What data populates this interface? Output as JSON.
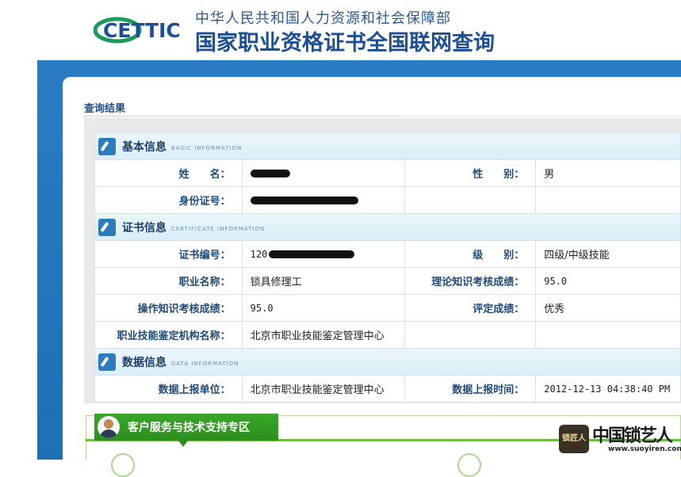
{
  "header": {
    "logo_text": "CETTIC",
    "org_name": "中华人民共和国人力资源和社会保障部",
    "site_title": "国家职业资格证书全国联网查询"
  },
  "result_title": "查询结果",
  "sections": {
    "basic": {
      "name": "基本信息",
      "en": "BASIC INFORMATION"
    },
    "cert": {
      "name": "证书信息",
      "en": "CERTIFICATE INFORMATION"
    },
    "data": {
      "name": "数据信息",
      "en": "DATA INFORMATION"
    }
  },
  "basic": {
    "name_label": "姓　　名：",
    "name_value": "",
    "gender_label": "性　　别：",
    "gender_value": "男",
    "id_label": "身份证号：",
    "id_value": ""
  },
  "cert": {
    "number_label": "证书编号：",
    "number_prefix": "120",
    "level_label": "级　　别：",
    "level_value": "四级/中级技能",
    "occupation_label": "职业名称：",
    "occupation_value": "锁具修理工",
    "theory_label": "理论知识考核成绩：",
    "theory_value": "95.0",
    "practice_label": "操作知识考核成绩：",
    "practice_value": "95.0",
    "rating_label": "评定成绩：",
    "rating_value": "优秀",
    "agency_label": "职业技能鉴定机构名称：",
    "agency_value": "北京市职业技能鉴定管理中心"
  },
  "data": {
    "unit_label": "数据上报单位：",
    "unit_value": "北京市职业技能鉴定管理中心",
    "time_label": "数据上报时间：",
    "time_value": "2012-12-13 04:38:40 PM"
  },
  "support": {
    "title": "客户服务与技术支持专区"
  },
  "watermark": {
    "seal": "锁匠人",
    "text": "中国锁艺人",
    "url": "www.suoyiren.com"
  },
  "colors": {
    "accent_blue": "#1f6fb6",
    "label_blue": "#1e4a7a",
    "support_green": "#2c8f1c"
  }
}
